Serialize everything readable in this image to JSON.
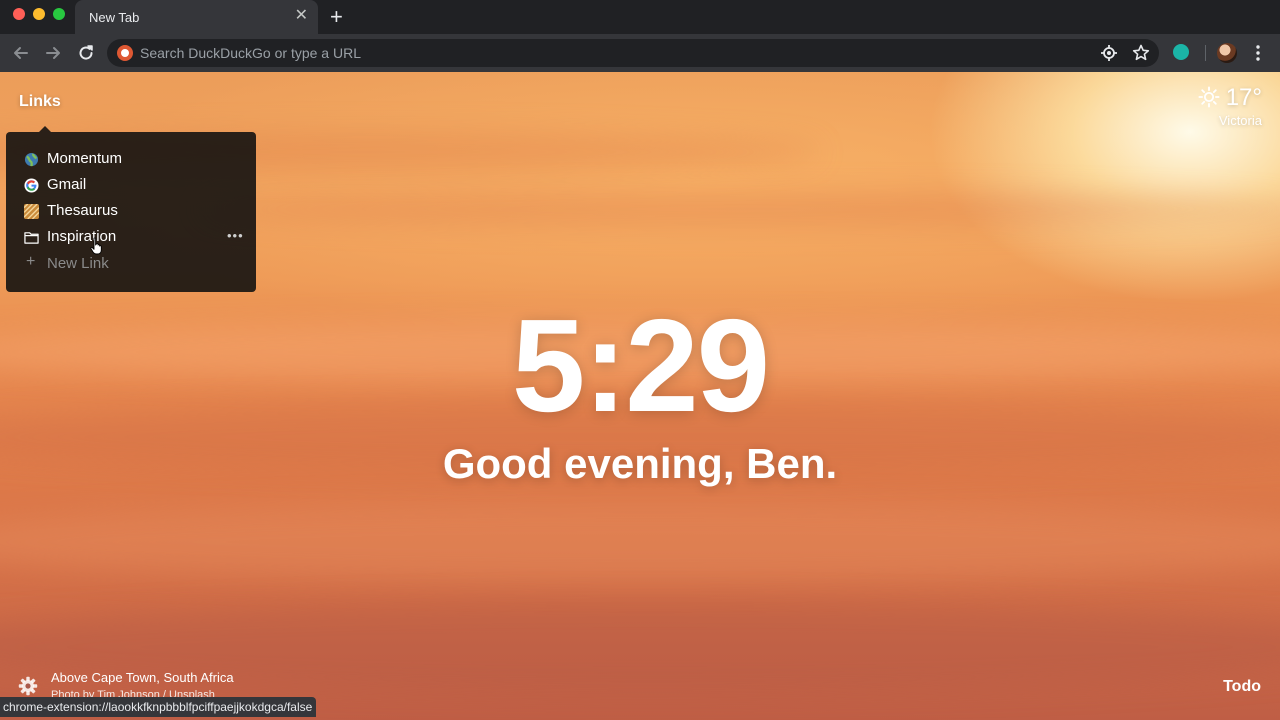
{
  "browser": {
    "tab_title": "New Tab",
    "tab_close": "✕",
    "new_tab": "+",
    "address_placeholder": "Search DuckDuckGo or type a URL",
    "status_url": "chrome-extension://laookkfknpbbblfpciffpaejjkokdgca/false"
  },
  "links": {
    "label": "Links",
    "items": [
      {
        "label": "Momentum",
        "icon": "globe-icon"
      },
      {
        "label": "Gmail",
        "icon": "google-icon"
      },
      {
        "label": "Thesaurus",
        "icon": "thesaurus-icon"
      },
      {
        "label": "Inspiration",
        "icon": "folder-icon",
        "more": "•••"
      }
    ],
    "new_link": "New Link",
    "new_link_plus": "+"
  },
  "weather": {
    "temperature": "17°",
    "location": "Victoria",
    "icon": "sun-icon"
  },
  "clock": {
    "time": "5:29",
    "greeting": "Good evening, Ben."
  },
  "footer": {
    "photo_location": "Above Cape Town, South Africa",
    "photo_credit": "Photo by Tim Johnson / Unsplash",
    "todo": "Todo"
  },
  "colors": {
    "brand_ddg": "#de5833",
    "extension": "#1bb5a7",
    "chrome_dark": "#202124",
    "chrome_toolbar": "#35363a"
  }
}
